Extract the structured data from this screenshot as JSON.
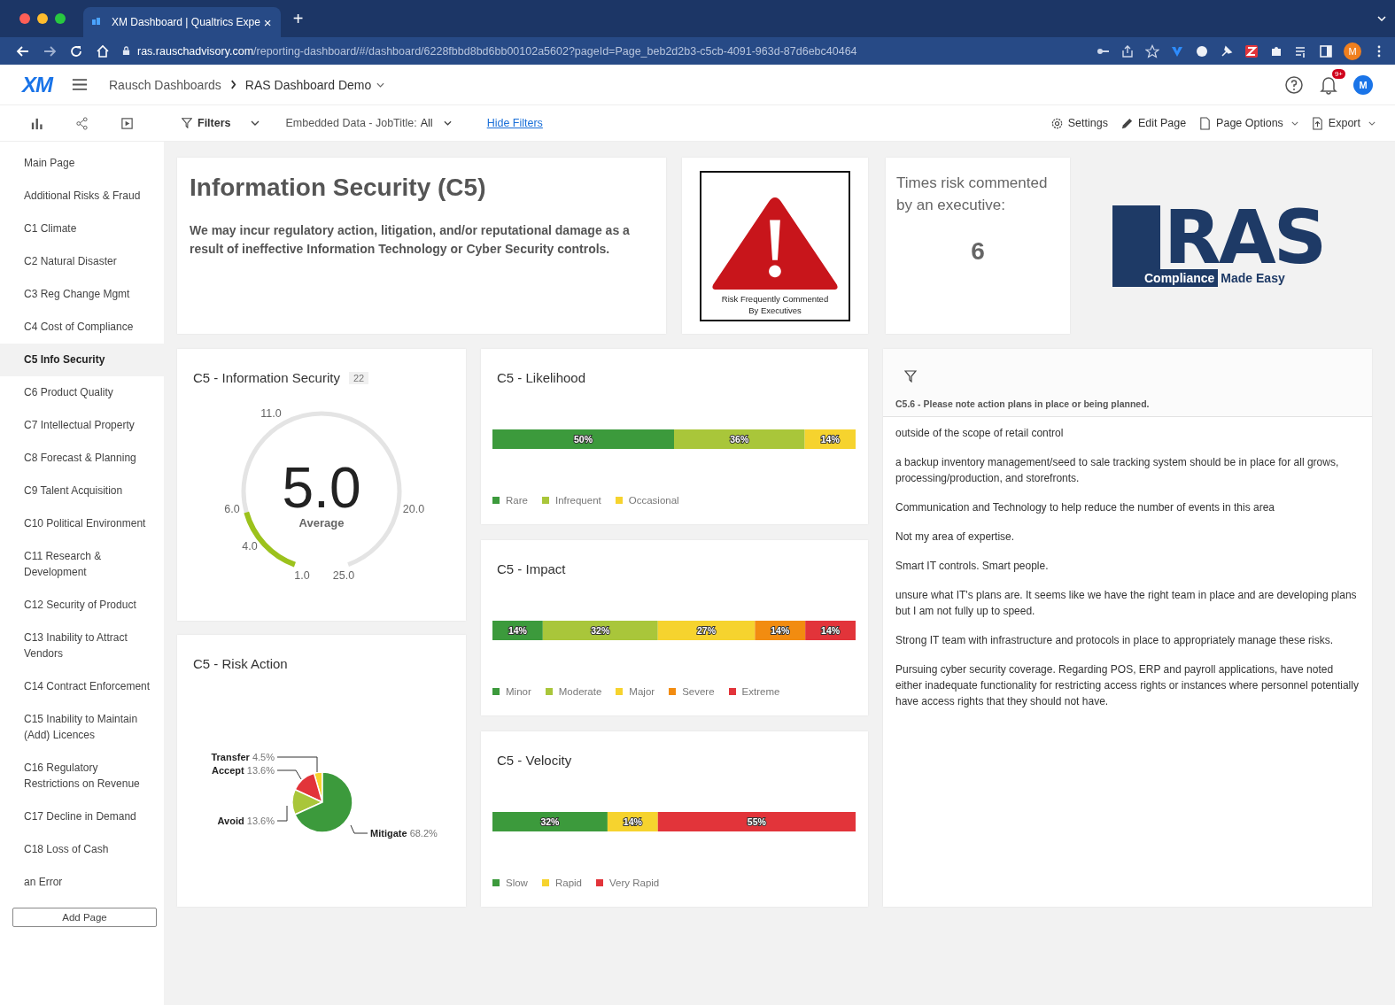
{
  "browser": {
    "tab_title": "XM Dashboard | Qualtrics Expe",
    "tab_close": "×",
    "new_tab": "+",
    "host": "ras.rauschadvisory.com",
    "path": "/reporting-dashboard/#/dashboard/6228fbbd8bd6bb00102a5602?pageId=Page_beb2d2b3-c5cb-4091-963d-87d6ebc40464",
    "profile_initial": "M"
  },
  "app_header": {
    "logo": "XM",
    "breadcrumbs": [
      "Rausch Dashboards",
      "RAS Dashboard Demo"
    ],
    "notification_badge": "9+",
    "avatar_initial": "M"
  },
  "toolbar": {
    "filters_label": "Filters",
    "filter_label": "Embedded Data - JobTitle:",
    "filter_value": "All",
    "hide_filters": "Hide Filters",
    "actions": [
      {
        "label": "Settings",
        "kind": "gear",
        "dropdown": false
      },
      {
        "label": "Edit Page",
        "kind": "pencil",
        "dropdown": false
      },
      {
        "label": "Page Options",
        "kind": "page",
        "dropdown": true
      },
      {
        "label": "Export",
        "kind": "export",
        "dropdown": true
      }
    ]
  },
  "sidebar": {
    "items": [
      {
        "label": "Main Page",
        "selected": false
      },
      {
        "label": "Additional Risks & Fraud",
        "selected": false
      },
      {
        "label": "C1 Climate",
        "selected": false
      },
      {
        "label": "C2 Natural Disaster",
        "selected": false
      },
      {
        "label": "C3 Reg Change Mgmt",
        "selected": false
      },
      {
        "label": "C4 Cost of Compliance",
        "selected": false
      },
      {
        "label": "C5 Info Security",
        "selected": true
      },
      {
        "label": "C6 Product Quality",
        "selected": false
      },
      {
        "label": "C7 Intellectual Property",
        "selected": false
      },
      {
        "label": "C8 Forecast & Planning",
        "selected": false
      },
      {
        "label": "C9 Talent Acquisition",
        "selected": false
      },
      {
        "label": "C10 Political Environment",
        "selected": false
      },
      {
        "label": "C11 Research & Development",
        "selected": false
      },
      {
        "label": "C12 Security of Product",
        "selected": false
      },
      {
        "label": "C13 Inability to Attract Vendors",
        "selected": false
      },
      {
        "label": "C14 Contract Enforcement",
        "selected": false
      },
      {
        "label": "C15 Inability to Maintain (Add) Licences",
        "selected": false
      },
      {
        "label": "C16 Regulatory Restrictions on Revenue",
        "selected": false
      },
      {
        "label": "C17 Decline in Demand",
        "selected": false
      },
      {
        "label": "C18 Loss of Cash",
        "selected": false
      },
      {
        "label": "an Error",
        "selected": false
      }
    ],
    "add_page": "Add Page"
  },
  "intro": {
    "title": "Information Security (C5)",
    "description": "We may incur regulatory action, litigation, and/or reputational damage as a result of ineffective Information Technology or Cyber Security controls."
  },
  "warning": {
    "caption_1": "Risk Frequently Commented",
    "caption_2": "By Executives"
  },
  "executive_count": {
    "label": "Times risk commented by an executive:",
    "value": "6"
  },
  "logo": {
    "mark": "RAS",
    "tagline_1": "Compliance",
    "tagline_2": "Made Easy"
  },
  "gauge": {
    "title": "C5 - Information Security",
    "count": "22",
    "value": "5.0",
    "caption": "Average",
    "ticks": [
      "11.0",
      "6.0",
      "4.0",
      "1.0",
      "25.0",
      "20.0"
    ]
  },
  "risk_action": {
    "title": "C5 - Risk Action",
    "chart_data": {
      "type": "pie",
      "categories": [
        "Transfer",
        "Accept",
        "Avoid",
        "Mitigate"
      ],
      "values": [
        4.5,
        13.6,
        13.6,
        68.2
      ],
      "value_labels": [
        "4.5%",
        "13.6%",
        "13.6%",
        "68.2%"
      ]
    }
  },
  "bars": [
    {
      "title": "C5 - Likelihood",
      "chart_data": {
        "type": "bar",
        "orientation": "horizontal",
        "stacked": true,
        "categories": [
          null
        ],
        "series": [
          {
            "name": "Rare",
            "color": "#3c9a3c",
            "values": [
              50
            ],
            "value_labels": [
              "50%"
            ]
          },
          {
            "name": "Infrequent",
            "color": "#a9c63a",
            "values": [
              36
            ],
            "value_labels": [
              "36%"
            ]
          },
          {
            "name": "Occasional",
            "color": "#f6d32e",
            "values": [
              14
            ],
            "value_labels": [
              "14%"
            ]
          }
        ]
      }
    },
    {
      "title": "C5 - Impact",
      "chart_data": {
        "type": "bar",
        "orientation": "horizontal",
        "stacked": true,
        "categories": [
          null
        ],
        "series": [
          {
            "name": "Minor",
            "color": "#3c9a3c",
            "values": [
              14
            ],
            "value_labels": [
              "14%"
            ]
          },
          {
            "name": "Moderate",
            "color": "#a9c63a",
            "values": [
              32
            ],
            "value_labels": [
              "32%"
            ]
          },
          {
            "name": "Major",
            "color": "#f6d32e",
            "values": [
              27
            ],
            "value_labels": [
              "27%"
            ]
          },
          {
            "name": "Severe",
            "color": "#f28c10",
            "values": [
              14
            ],
            "value_labels": [
              "14%"
            ]
          },
          {
            "name": "Extreme",
            "color": "#e2343a",
            "values": [
              14
            ],
            "value_labels": [
              "14%"
            ]
          }
        ]
      }
    },
    {
      "title": "C5 - Velocity",
      "chart_data": {
        "type": "bar",
        "orientation": "horizontal",
        "stacked": true,
        "categories": [
          null
        ],
        "series": [
          {
            "name": "Slow",
            "color": "#3c9a3c",
            "values": [
              32
            ],
            "value_labels": [
              "32%"
            ]
          },
          {
            "name": "Rapid",
            "color": "#f6d32e",
            "values": [
              14
            ],
            "value_labels": [
              "14%"
            ]
          },
          {
            "name": "Very Rapid",
            "color": "#e2343a",
            "values": [
              55
            ],
            "value_labels": [
              "55%"
            ]
          }
        ]
      }
    }
  ],
  "comments": {
    "question": "C5.6 - Please note action plans in place or being planned.",
    "responses": [
      "outside of the scope of retail control",
      "a backup inventory management/seed to sale tracking system should be in place for all grows, processing/production, and storefronts.",
      "Communication and Technology to help reduce the number of events in this area",
      "Not my area of expertise.",
      "Smart IT controls. Smart people.",
      "unsure what IT's plans are. It seems like we have the right team in place and are developing plans but I am not fully up to speed.",
      "Strong IT team with infrastructure and protocols in place to appropriately manage these risks.",
      "Pursuing cyber security coverage. Regarding POS, ERP and payroll applications, have noted either inadequate functionality for restricting access rights or instances where personnel potentially have access rights that they should not have."
    ]
  }
}
